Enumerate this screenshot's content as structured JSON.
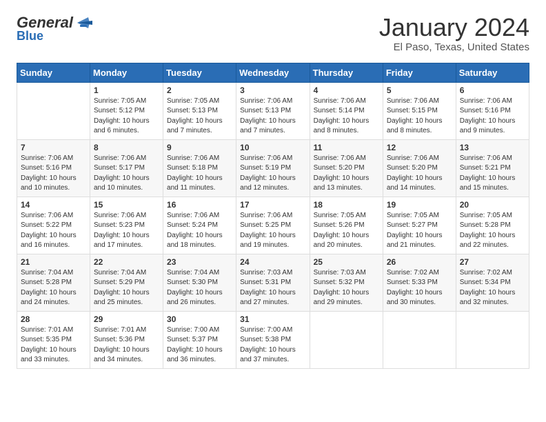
{
  "header": {
    "logo_general": "General",
    "logo_blue": "Blue",
    "month": "January 2024",
    "location": "El Paso, Texas, United States"
  },
  "calendar": {
    "days": [
      "Sunday",
      "Monday",
      "Tuesday",
      "Wednesday",
      "Thursday",
      "Friday",
      "Saturday"
    ],
    "weeks": [
      [
        {
          "day": "",
          "content": ""
        },
        {
          "day": "1",
          "content": "Sunrise: 7:05 AM\nSunset: 5:12 PM\nDaylight: 10 hours\nand 6 minutes."
        },
        {
          "day": "2",
          "content": "Sunrise: 7:05 AM\nSunset: 5:13 PM\nDaylight: 10 hours\nand 7 minutes."
        },
        {
          "day": "3",
          "content": "Sunrise: 7:06 AM\nSunset: 5:13 PM\nDaylight: 10 hours\nand 7 minutes."
        },
        {
          "day": "4",
          "content": "Sunrise: 7:06 AM\nSunset: 5:14 PM\nDaylight: 10 hours\nand 8 minutes."
        },
        {
          "day": "5",
          "content": "Sunrise: 7:06 AM\nSunset: 5:15 PM\nDaylight: 10 hours\nand 8 minutes."
        },
        {
          "day": "6",
          "content": "Sunrise: 7:06 AM\nSunset: 5:16 PM\nDaylight: 10 hours\nand 9 minutes."
        }
      ],
      [
        {
          "day": "7",
          "content": "Sunrise: 7:06 AM\nSunset: 5:16 PM\nDaylight: 10 hours\nand 10 minutes."
        },
        {
          "day": "8",
          "content": "Sunrise: 7:06 AM\nSunset: 5:17 PM\nDaylight: 10 hours\nand 10 minutes."
        },
        {
          "day": "9",
          "content": "Sunrise: 7:06 AM\nSunset: 5:18 PM\nDaylight: 10 hours\nand 11 minutes."
        },
        {
          "day": "10",
          "content": "Sunrise: 7:06 AM\nSunset: 5:19 PM\nDaylight: 10 hours\nand 12 minutes."
        },
        {
          "day": "11",
          "content": "Sunrise: 7:06 AM\nSunset: 5:20 PM\nDaylight: 10 hours\nand 13 minutes."
        },
        {
          "day": "12",
          "content": "Sunrise: 7:06 AM\nSunset: 5:20 PM\nDaylight: 10 hours\nand 14 minutes."
        },
        {
          "day": "13",
          "content": "Sunrise: 7:06 AM\nSunset: 5:21 PM\nDaylight: 10 hours\nand 15 minutes."
        }
      ],
      [
        {
          "day": "14",
          "content": "Sunrise: 7:06 AM\nSunset: 5:22 PM\nDaylight: 10 hours\nand 16 minutes."
        },
        {
          "day": "15",
          "content": "Sunrise: 7:06 AM\nSunset: 5:23 PM\nDaylight: 10 hours\nand 17 minutes."
        },
        {
          "day": "16",
          "content": "Sunrise: 7:06 AM\nSunset: 5:24 PM\nDaylight: 10 hours\nand 18 minutes."
        },
        {
          "day": "17",
          "content": "Sunrise: 7:06 AM\nSunset: 5:25 PM\nDaylight: 10 hours\nand 19 minutes."
        },
        {
          "day": "18",
          "content": "Sunrise: 7:05 AM\nSunset: 5:26 PM\nDaylight: 10 hours\nand 20 minutes."
        },
        {
          "day": "19",
          "content": "Sunrise: 7:05 AM\nSunset: 5:27 PM\nDaylight: 10 hours\nand 21 minutes."
        },
        {
          "day": "20",
          "content": "Sunrise: 7:05 AM\nSunset: 5:28 PM\nDaylight: 10 hours\nand 22 minutes."
        }
      ],
      [
        {
          "day": "21",
          "content": "Sunrise: 7:04 AM\nSunset: 5:28 PM\nDaylight: 10 hours\nand 24 minutes."
        },
        {
          "day": "22",
          "content": "Sunrise: 7:04 AM\nSunset: 5:29 PM\nDaylight: 10 hours\nand 25 minutes."
        },
        {
          "day": "23",
          "content": "Sunrise: 7:04 AM\nSunset: 5:30 PM\nDaylight: 10 hours\nand 26 minutes."
        },
        {
          "day": "24",
          "content": "Sunrise: 7:03 AM\nSunset: 5:31 PM\nDaylight: 10 hours\nand 27 minutes."
        },
        {
          "day": "25",
          "content": "Sunrise: 7:03 AM\nSunset: 5:32 PM\nDaylight: 10 hours\nand 29 minutes."
        },
        {
          "day": "26",
          "content": "Sunrise: 7:02 AM\nSunset: 5:33 PM\nDaylight: 10 hours\nand 30 minutes."
        },
        {
          "day": "27",
          "content": "Sunrise: 7:02 AM\nSunset: 5:34 PM\nDaylight: 10 hours\nand 32 minutes."
        }
      ],
      [
        {
          "day": "28",
          "content": "Sunrise: 7:01 AM\nSunset: 5:35 PM\nDaylight: 10 hours\nand 33 minutes."
        },
        {
          "day": "29",
          "content": "Sunrise: 7:01 AM\nSunset: 5:36 PM\nDaylight: 10 hours\nand 34 minutes."
        },
        {
          "day": "30",
          "content": "Sunrise: 7:00 AM\nSunset: 5:37 PM\nDaylight: 10 hours\nand 36 minutes."
        },
        {
          "day": "31",
          "content": "Sunrise: 7:00 AM\nSunset: 5:38 PM\nDaylight: 10 hours\nand 37 minutes."
        },
        {
          "day": "",
          "content": ""
        },
        {
          "day": "",
          "content": ""
        },
        {
          "day": "",
          "content": ""
        }
      ]
    ]
  }
}
